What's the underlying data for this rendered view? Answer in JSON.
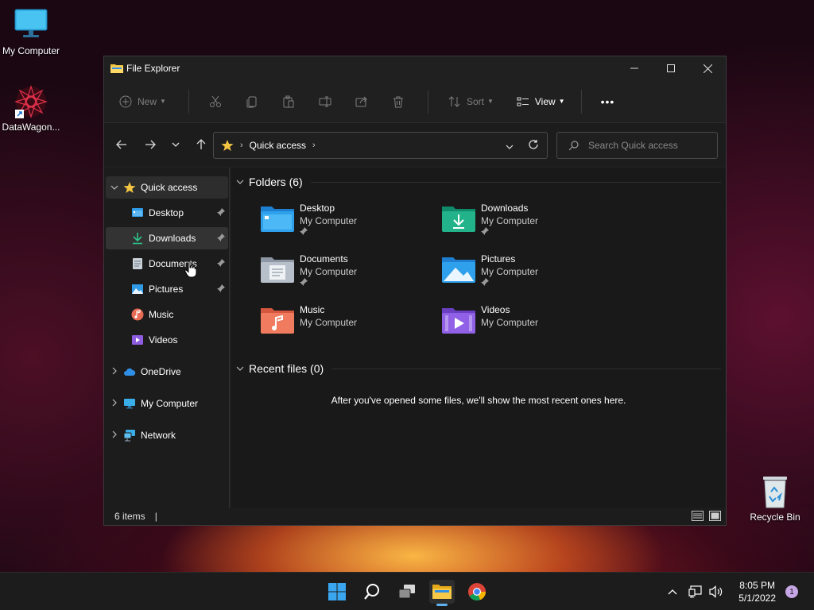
{
  "desktop": {
    "icons": [
      {
        "label": "My Computer"
      },
      {
        "label": "DataWagon..."
      },
      {
        "label": "Recycle Bin"
      }
    ]
  },
  "window": {
    "title": "File Explorer",
    "toolbar": {
      "new_label": "New",
      "sort_label": "Sort",
      "view_label": "View",
      "more_label": "•••"
    },
    "address": {
      "location": "Quick access"
    },
    "search": {
      "placeholder": "Search Quick access"
    },
    "sidebar": {
      "items": [
        {
          "label": "Quick access"
        },
        {
          "label": "Desktop"
        },
        {
          "label": "Downloads"
        },
        {
          "label": "Documents"
        },
        {
          "label": "Pictures"
        },
        {
          "label": "Music"
        },
        {
          "label": "Videos"
        },
        {
          "label": "OneDrive"
        },
        {
          "label": "My Computer"
        },
        {
          "label": "Network"
        }
      ]
    },
    "content": {
      "folders_header": "Folders (6)",
      "folders": [
        {
          "name": "Desktop",
          "location": "My Computer"
        },
        {
          "name": "Downloads",
          "location": "My Computer"
        },
        {
          "name": "Documents",
          "location": "My Computer"
        },
        {
          "name": "Pictures",
          "location": "My Computer"
        },
        {
          "name": "Music",
          "location": "My Computer"
        },
        {
          "name": "Videos",
          "location": "My Computer"
        }
      ],
      "recent_header": "Recent files (0)",
      "recent_empty": "After you've opened some files, we'll show the most recent ones here."
    },
    "status": {
      "items": "6 items",
      "divider": "|"
    }
  },
  "taskbar": {
    "time": "8:05 PM",
    "date": "5/1/2022",
    "notifications": "1"
  },
  "colors": {
    "accent": "#0078d4",
    "folder_yellow": "#f4c542",
    "selection": "#333333"
  }
}
